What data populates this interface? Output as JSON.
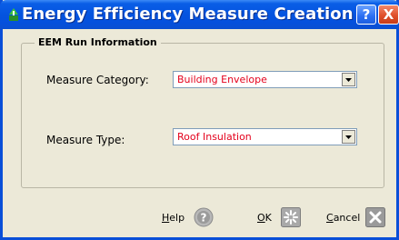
{
  "window": {
    "title": "Energy Efficiency Measure Creation",
    "help_glyph": "?",
    "close_glyph": "X"
  },
  "group": {
    "legend": "EEM Run Information"
  },
  "fields": {
    "measure_category": {
      "label": "Measure Category:",
      "value": "Building Envelope"
    },
    "measure_type": {
      "label": "Measure Type:",
      "value": "Roof Insulation"
    }
  },
  "buttons": {
    "help": {
      "label_first": "H",
      "label_rest": "elp",
      "icon": "question-circle-icon"
    },
    "ok": {
      "label_first": "O",
      "label_rest": "K",
      "icon": "starburst-icon"
    },
    "cancel": {
      "label_first": "C",
      "label_rest": "ancel",
      "icon": "close-x-icon"
    }
  },
  "colors": {
    "titlebar": "#0454e0",
    "window_bg": "#ece9d8",
    "combo_text": "#e4001b"
  }
}
